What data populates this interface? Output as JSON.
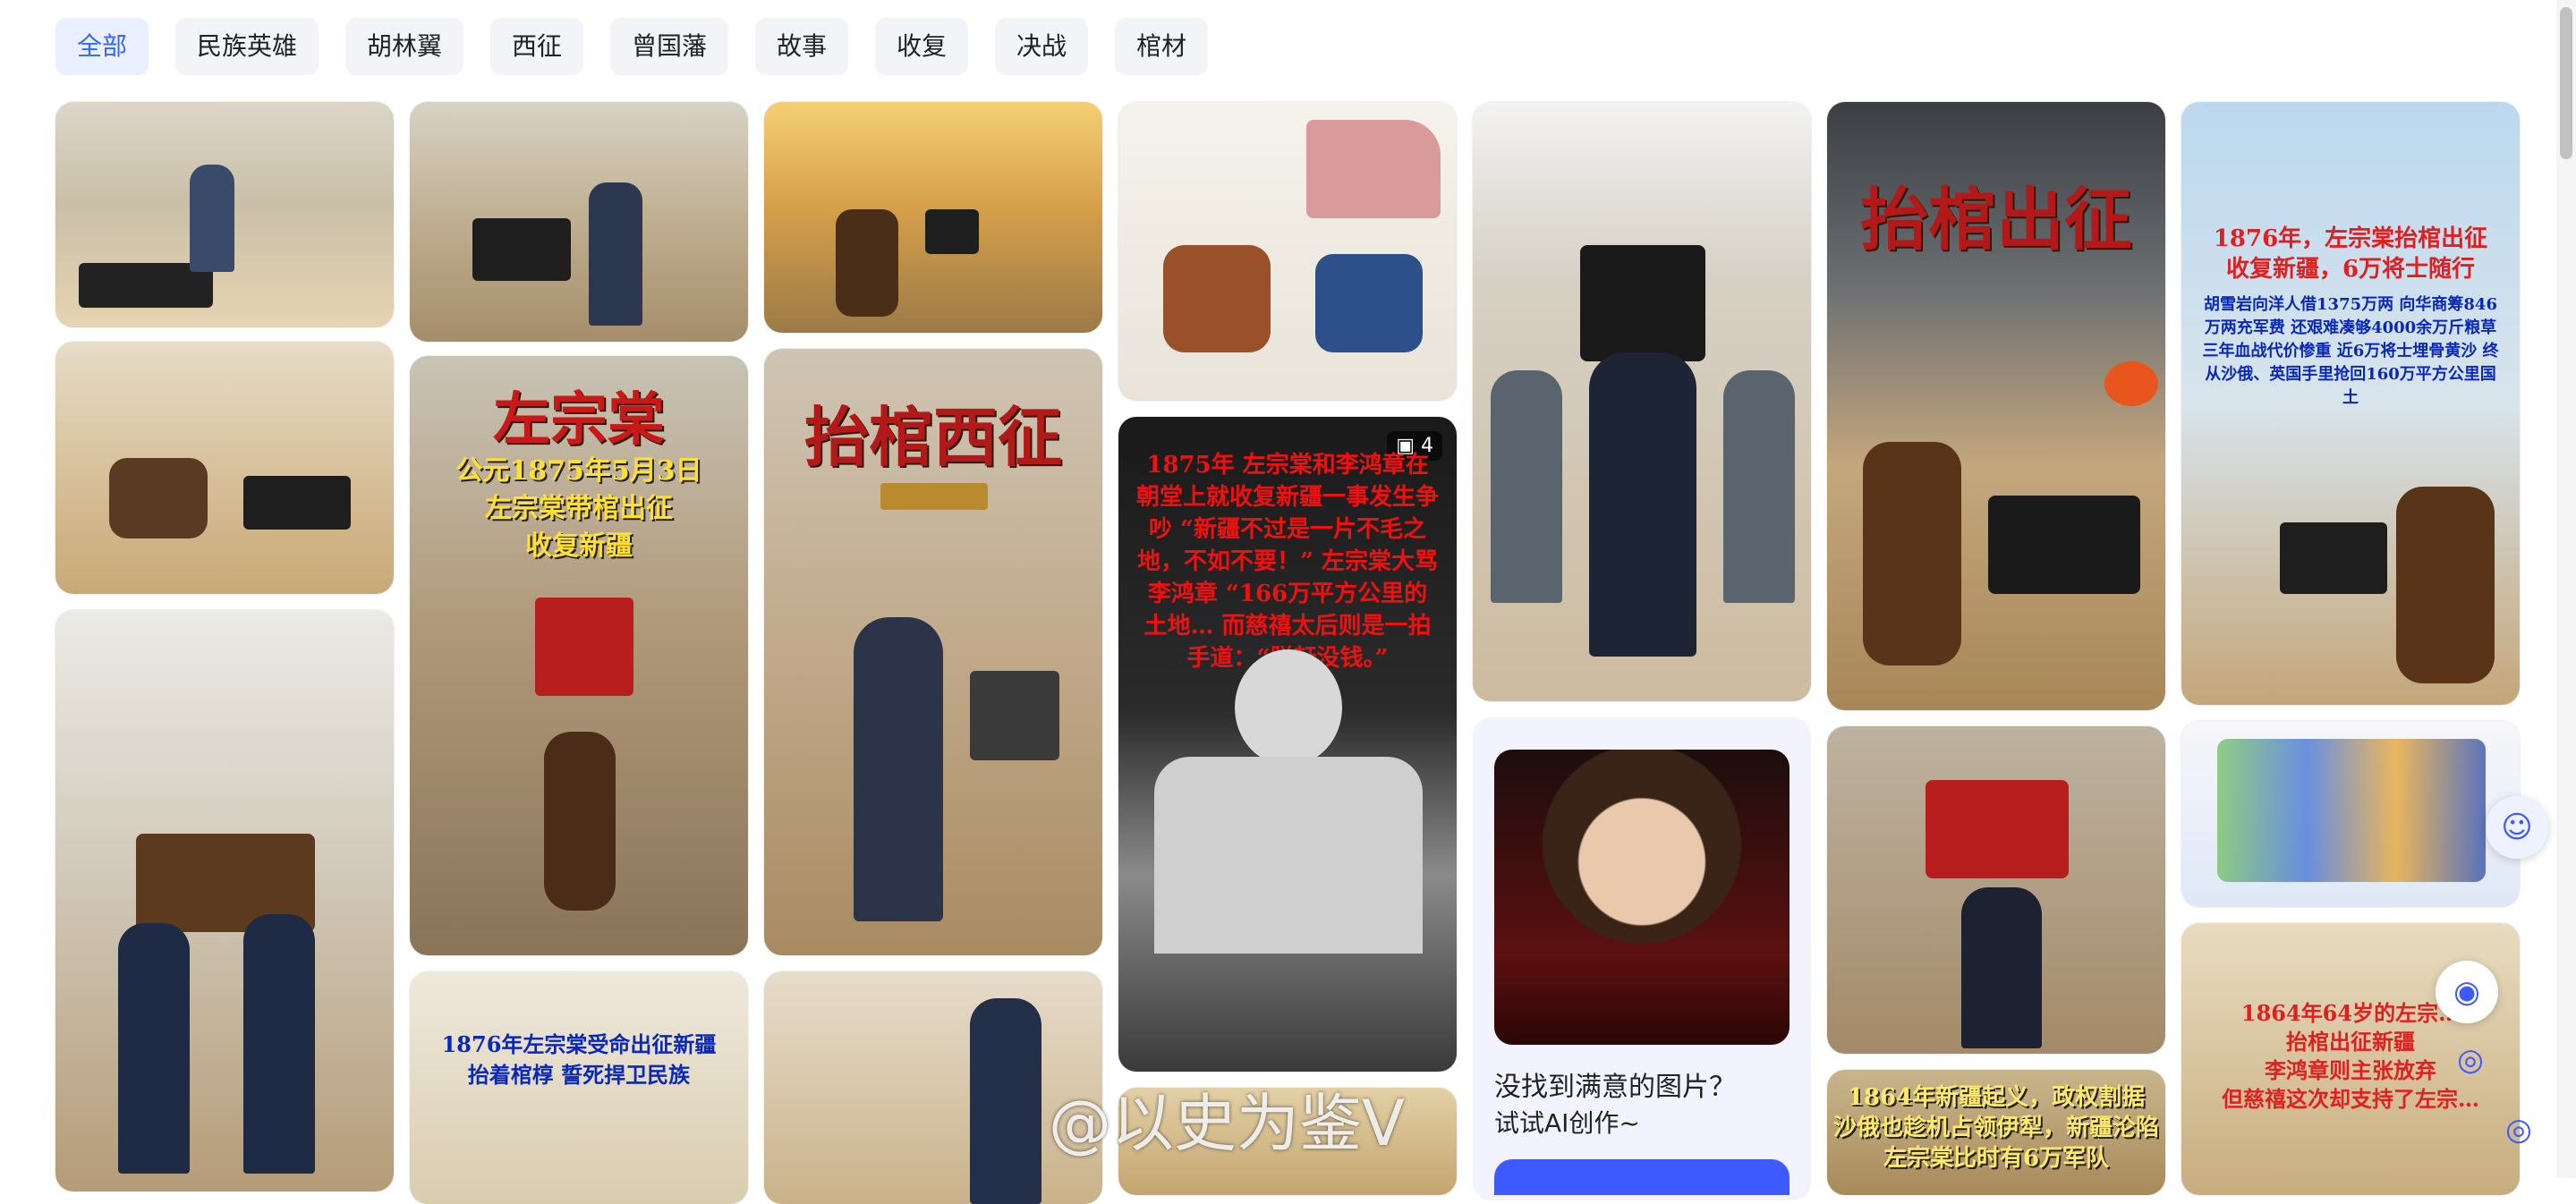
{
  "filters": {
    "tabs": [
      {
        "label": "全部",
        "active": true
      },
      {
        "label": "民族英雄"
      },
      {
        "label": "胡林翼"
      },
      {
        "label": "西征"
      },
      {
        "label": "曾国藩"
      },
      {
        "label": "故事"
      },
      {
        "label": "收复"
      },
      {
        "label": "决战"
      },
      {
        "label": "棺材"
      }
    ]
  },
  "cards": {
    "c3_title": "抬棺西征",
    "c2_title": "左宗棠",
    "c2_sub1": "公元1875年5月3日",
    "c2_sub2": "左宗棠带棺出征",
    "c2_sub3": "收复新疆",
    "c2b_line1": "1876年左宗棠受命出征新疆",
    "c2b_line2": "抬着棺椁 誓死捍卫民族",
    "c4b_badge": "4",
    "c4b_text": "1875年 左宗棠和李鸿章在朝堂上就收复新疆一事发生争吵 “新疆不过是一片不毛之地，不如不要！” 左宗棠大骂李鸿章 “166万平方公里的土地… 而慈禧太后则是一拍手道：“朕赶没钱。”",
    "c6_title": "抬棺出征",
    "c7_line1": "1876年，左宗棠抬棺出征",
    "c7_line2": "收复新疆，6万将士随行",
    "c7_body": "胡雪岩向洋人借1375万两 向华商筹846万两充军费 还艰难凑够4000余万斤粮草 三年血战代价惨重 近6万将士埋骨黄沙 终从沙俄、英国手里抢回160万平方公里国土",
    "c7d_line1": "1864年64岁的左宗…",
    "c7d_line2": "抬棺出征新疆",
    "c7d_line3": "李鸿章则主张放弃",
    "c7d_line4": "但慈禧这次却支持了左宗…",
    "c6c_line1": "1864年新疆起义，政权割据",
    "c6c_line2": "沙俄也趁机占领伊犁，新疆沦陷",
    "c6c_line3": "左宗棠比时有6万军队"
  },
  "ai_card": {
    "title": "没找到满意的图片？",
    "subtitle": "试试AI创作~"
  },
  "watermark": "@以史为鉴V"
}
